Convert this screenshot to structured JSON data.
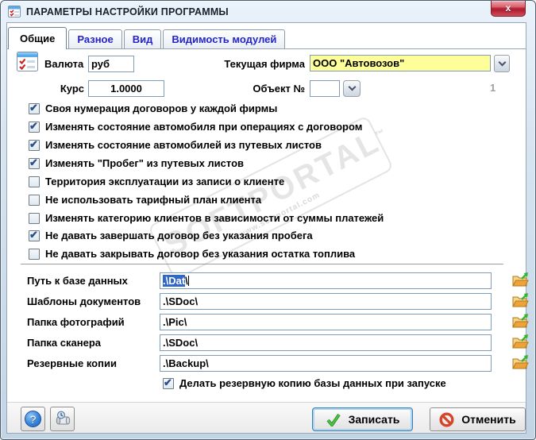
{
  "window": {
    "title": "ПАРАМЕТРЫ НАСТРОЙКИ ПРОГРАММЫ",
    "close_label": "x"
  },
  "tabs": [
    {
      "label": "Общие",
      "active": true
    },
    {
      "label": "Разное",
      "active": false
    },
    {
      "label": "Вид",
      "active": false
    },
    {
      "label": "Видимость модулей",
      "active": false
    }
  ],
  "general": {
    "currency_label": "Валюта",
    "currency_value": "руб",
    "rate_label": "Курс",
    "rate_value": "1.0000",
    "firm_label": "Текущая фирма",
    "firm_value": "ООО \"Автовозов\"",
    "object_label": "Объект №",
    "object_value": "",
    "object_ghost_number": "1"
  },
  "checkboxes": [
    {
      "label": "Своя нумерация договоров у каждой фирмы",
      "checked": true
    },
    {
      "label": "Изменять состояние автомобиля при операциях с договором",
      "checked": true
    },
    {
      "label": "Изменять состояние автомобилей из путевых листов",
      "checked": true
    },
    {
      "label": "Изменять \"Пробег\" из путевых листов",
      "checked": true
    },
    {
      "label": "Территория эксплуатации из записи о клиенте",
      "checked": false
    },
    {
      "label": "Не использовать тарифный план клиента",
      "checked": false
    },
    {
      "label": "Изменять категорию клиентов в зависимости от суммы платежей",
      "checked": false
    },
    {
      "label": "Не давать завершать договор без указания пробега",
      "checked": true
    },
    {
      "label": "Не давать закрывать договор без указания остатка топлива",
      "checked": false
    }
  ],
  "paths": [
    {
      "label": "Путь к базе данных",
      "value": ".\\Dat\\",
      "selected_part": ".\\Dat",
      "rest": "\\"
    },
    {
      "label": "Шаблоны документов",
      "value": ".\\SDoc\\"
    },
    {
      "label": "Папка фотографий",
      "value": ".\\Pic\\"
    },
    {
      "label": "Папка сканера",
      "value": ".\\SDoc\\"
    },
    {
      "label": "Резервные копии",
      "value": ".\\Backup\\"
    }
  ],
  "backup_checkbox": {
    "label": "Делать резервную копию базы данных при запуске",
    "checked": true
  },
  "footer": {
    "save_label": "Записать",
    "cancel_label": "Отменить"
  },
  "watermark": {
    "text": "SOFTPORTAL",
    "tm": "™",
    "url": "www.softportal.com"
  },
  "colors": {
    "firm-bg": "#ffff99",
    "tab-blue": "#2323cc",
    "sel-bg": "#3167c6",
    "close-red": "#c02f3f",
    "check-green": "#3fae3f",
    "cancel-red": "#d6452a",
    "check-blue": "#2b4e8c"
  }
}
